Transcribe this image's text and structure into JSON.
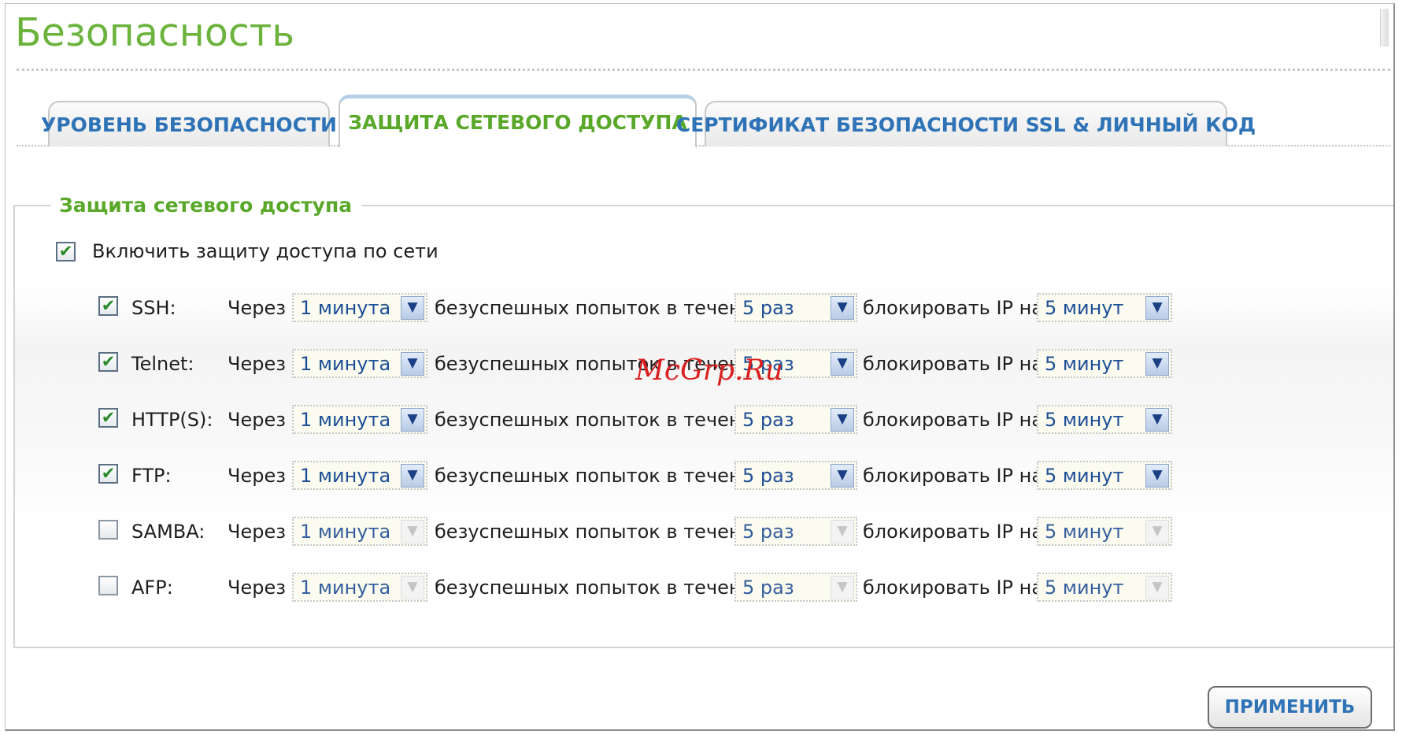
{
  "page": {
    "title": "Безопасность"
  },
  "tabs": [
    {
      "label": "УРОВЕНЬ БЕЗОПАСНОСТИ",
      "active": false
    },
    {
      "label": "ЗАЩИТА СЕТЕВОГО ДОСТУПА",
      "active": true
    },
    {
      "label": "СЕРТИФИКАТ БЕЗОПАСНОСТИ SSL & ЛИЧНЫЙ КОД",
      "active": false
    }
  ],
  "section": {
    "legend": "Защита сетевого доступа",
    "enable_label": "Включить защиту доступа по сети",
    "enable_checked": true
  },
  "rows": [
    {
      "service": "SSH:",
      "checked": true,
      "prefix": "Через",
      "interval": "1 минута",
      "middle": "безуспешных попыток в течение",
      "attempts": "5 раз",
      "suffix": "блокировать IP на",
      "block": "5 минут"
    },
    {
      "service": "Telnet:",
      "checked": true,
      "prefix": "Через",
      "interval": "1 минута",
      "middle": "безуспешных попыток в течение",
      "attempts": "5 раз",
      "suffix": "блокировать IP на",
      "block": "5 минут"
    },
    {
      "service": "HTTP(S):",
      "checked": true,
      "prefix": "Через",
      "interval": "1 минута",
      "middle": "безуспешных попыток в течение",
      "attempts": "5 раз",
      "suffix": "блокировать IP на",
      "block": "5 минут"
    },
    {
      "service": "FTP:",
      "checked": true,
      "prefix": "Через",
      "interval": "1 минута",
      "middle": "безуспешных попыток в течение",
      "attempts": "5 раз",
      "suffix": "блокировать IP на",
      "block": "5 минут"
    },
    {
      "service": "SAMBA:",
      "checked": false,
      "prefix": "Через",
      "interval": "1 минута",
      "middle": "безуспешных попыток в течение",
      "attempts": "5 раз",
      "suffix": "блокировать IP на",
      "block": "5 минут"
    },
    {
      "service": "AFP:",
      "checked": false,
      "prefix": "Через",
      "interval": "1 минута",
      "middle": "безуспешных попыток в течение",
      "attempts": "5 раз",
      "suffix": "блокировать IP на",
      "block": "5 минут"
    }
  ],
  "actions": {
    "apply_label": "ПРИМЕНИТЬ"
  },
  "watermark": "McGrp.Ru",
  "icons": {
    "checkbox_checked": "check-icon",
    "dropdown": "chevron-down-icon"
  },
  "colors": {
    "title_green": "#6cb33e",
    "tab_blue": "#2f73b7",
    "active_green": "#5aa82a",
    "value_blue": "#1e4f96"
  }
}
